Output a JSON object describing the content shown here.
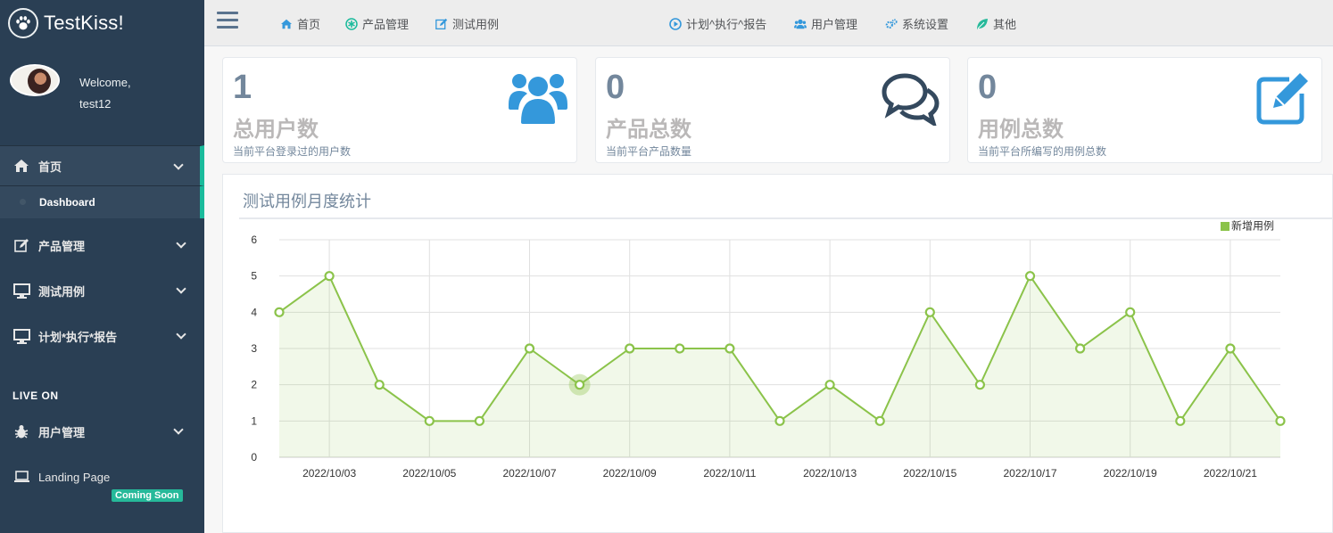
{
  "brand": {
    "title": "TestKiss!"
  },
  "profile": {
    "welcome": "Welcome,",
    "username": "test12"
  },
  "sidebar": {
    "items": [
      {
        "label": "首页"
      },
      {
        "label": "Dashboard"
      },
      {
        "label": "产品管理"
      },
      {
        "label": "测试用例"
      },
      {
        "label": "计划*执行*报告"
      }
    ],
    "section_title": "LIVE ON",
    "live": [
      {
        "label": "用户管理"
      },
      {
        "label": "Landing Page"
      }
    ],
    "badge": "Coming Soon"
  },
  "topnav": {
    "items": [
      {
        "label": "首页"
      },
      {
        "label": "产品管理"
      },
      {
        "label": "测试用例"
      },
      {
        "label": "计划^执行^报告"
      },
      {
        "label": "用户管理"
      },
      {
        "label": "系统设置"
      },
      {
        "label": "其他"
      }
    ]
  },
  "tiles": [
    {
      "count": "1",
      "title": "总用户数",
      "desc": "当前平台登录过的用户数"
    },
    {
      "count": "0",
      "title": "产品总数",
      "desc": "当前平台产品数量"
    },
    {
      "count": "0",
      "title": "用例总数",
      "desc": "当前平台所编写的用例总数"
    }
  ],
  "panel": {
    "title": "测试用例月度统计"
  },
  "colors": {
    "sidebar": "#2a3f54",
    "accent": "#1abb9c",
    "line": "#8bc34a",
    "tile_icon_blue": "#3498db",
    "tile_icon_dark": "#34495e"
  },
  "chart_data": {
    "type": "line",
    "x": [
      "2022/10/02",
      "2022/10/03",
      "2022/10/04",
      "2022/10/05",
      "2022/10/06",
      "2022/10/07",
      "2022/10/08",
      "2022/10/09",
      "2022/10/10",
      "2022/10/11",
      "2022/10/12",
      "2022/10/13",
      "2022/10/14",
      "2022/10/15",
      "2022/10/16",
      "2022/10/17",
      "2022/10/18",
      "2022/10/19",
      "2022/10/20",
      "2022/10/21",
      "2022/10/22"
    ],
    "xticks": [
      "2022/10/03",
      "2022/10/05",
      "2022/10/07",
      "2022/10/09",
      "2022/10/11",
      "2022/10/13",
      "2022/10/15",
      "2022/10/17",
      "2022/10/19",
      "2022/10/21"
    ],
    "series": [
      {
        "name": "新增用例",
        "values": [
          4,
          5,
          2,
          1,
          1,
          3,
          2,
          3,
          3,
          3,
          1,
          2,
          1,
          4,
          2,
          5,
          3,
          4,
          1,
          3,
          1
        ]
      }
    ],
    "ylim": [
      0,
      6
    ],
    "yticks": [
      0,
      1,
      2,
      3,
      4,
      5,
      6
    ],
    "highlight_index": 6,
    "grid": true,
    "legend": "top-right"
  }
}
